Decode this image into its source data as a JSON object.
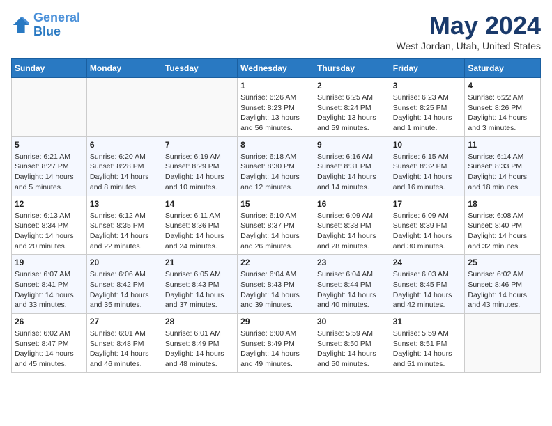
{
  "header": {
    "logo_line1": "General",
    "logo_line2": "Blue",
    "month": "May 2024",
    "location": "West Jordan, Utah, United States"
  },
  "weekdays": [
    "Sunday",
    "Monday",
    "Tuesday",
    "Wednesday",
    "Thursday",
    "Friday",
    "Saturday"
  ],
  "weeks": [
    [
      {
        "day": "",
        "info": ""
      },
      {
        "day": "",
        "info": ""
      },
      {
        "day": "",
        "info": ""
      },
      {
        "day": "1",
        "info": "Sunrise: 6:26 AM\nSunset: 8:23 PM\nDaylight: 13 hours\nand 56 minutes."
      },
      {
        "day": "2",
        "info": "Sunrise: 6:25 AM\nSunset: 8:24 PM\nDaylight: 13 hours\nand 59 minutes."
      },
      {
        "day": "3",
        "info": "Sunrise: 6:23 AM\nSunset: 8:25 PM\nDaylight: 14 hours\nand 1 minute."
      },
      {
        "day": "4",
        "info": "Sunrise: 6:22 AM\nSunset: 8:26 PM\nDaylight: 14 hours\nand 3 minutes."
      }
    ],
    [
      {
        "day": "5",
        "info": "Sunrise: 6:21 AM\nSunset: 8:27 PM\nDaylight: 14 hours\nand 5 minutes."
      },
      {
        "day": "6",
        "info": "Sunrise: 6:20 AM\nSunset: 8:28 PM\nDaylight: 14 hours\nand 8 minutes."
      },
      {
        "day": "7",
        "info": "Sunrise: 6:19 AM\nSunset: 8:29 PM\nDaylight: 14 hours\nand 10 minutes."
      },
      {
        "day": "8",
        "info": "Sunrise: 6:18 AM\nSunset: 8:30 PM\nDaylight: 14 hours\nand 12 minutes."
      },
      {
        "day": "9",
        "info": "Sunrise: 6:16 AM\nSunset: 8:31 PM\nDaylight: 14 hours\nand 14 minutes."
      },
      {
        "day": "10",
        "info": "Sunrise: 6:15 AM\nSunset: 8:32 PM\nDaylight: 14 hours\nand 16 minutes."
      },
      {
        "day": "11",
        "info": "Sunrise: 6:14 AM\nSunset: 8:33 PM\nDaylight: 14 hours\nand 18 minutes."
      }
    ],
    [
      {
        "day": "12",
        "info": "Sunrise: 6:13 AM\nSunset: 8:34 PM\nDaylight: 14 hours\nand 20 minutes."
      },
      {
        "day": "13",
        "info": "Sunrise: 6:12 AM\nSunset: 8:35 PM\nDaylight: 14 hours\nand 22 minutes."
      },
      {
        "day": "14",
        "info": "Sunrise: 6:11 AM\nSunset: 8:36 PM\nDaylight: 14 hours\nand 24 minutes."
      },
      {
        "day": "15",
        "info": "Sunrise: 6:10 AM\nSunset: 8:37 PM\nDaylight: 14 hours\nand 26 minutes."
      },
      {
        "day": "16",
        "info": "Sunrise: 6:09 AM\nSunset: 8:38 PM\nDaylight: 14 hours\nand 28 minutes."
      },
      {
        "day": "17",
        "info": "Sunrise: 6:09 AM\nSunset: 8:39 PM\nDaylight: 14 hours\nand 30 minutes."
      },
      {
        "day": "18",
        "info": "Sunrise: 6:08 AM\nSunset: 8:40 PM\nDaylight: 14 hours\nand 32 minutes."
      }
    ],
    [
      {
        "day": "19",
        "info": "Sunrise: 6:07 AM\nSunset: 8:41 PM\nDaylight: 14 hours\nand 33 minutes."
      },
      {
        "day": "20",
        "info": "Sunrise: 6:06 AM\nSunset: 8:42 PM\nDaylight: 14 hours\nand 35 minutes."
      },
      {
        "day": "21",
        "info": "Sunrise: 6:05 AM\nSunset: 8:43 PM\nDaylight: 14 hours\nand 37 minutes."
      },
      {
        "day": "22",
        "info": "Sunrise: 6:04 AM\nSunset: 8:43 PM\nDaylight: 14 hours\nand 39 minutes."
      },
      {
        "day": "23",
        "info": "Sunrise: 6:04 AM\nSunset: 8:44 PM\nDaylight: 14 hours\nand 40 minutes."
      },
      {
        "day": "24",
        "info": "Sunrise: 6:03 AM\nSunset: 8:45 PM\nDaylight: 14 hours\nand 42 minutes."
      },
      {
        "day": "25",
        "info": "Sunrise: 6:02 AM\nSunset: 8:46 PM\nDaylight: 14 hours\nand 43 minutes."
      }
    ],
    [
      {
        "day": "26",
        "info": "Sunrise: 6:02 AM\nSunset: 8:47 PM\nDaylight: 14 hours\nand 45 minutes."
      },
      {
        "day": "27",
        "info": "Sunrise: 6:01 AM\nSunset: 8:48 PM\nDaylight: 14 hours\nand 46 minutes."
      },
      {
        "day": "28",
        "info": "Sunrise: 6:01 AM\nSunset: 8:49 PM\nDaylight: 14 hours\nand 48 minutes."
      },
      {
        "day": "29",
        "info": "Sunrise: 6:00 AM\nSunset: 8:49 PM\nDaylight: 14 hours\nand 49 minutes."
      },
      {
        "day": "30",
        "info": "Sunrise: 5:59 AM\nSunset: 8:50 PM\nDaylight: 14 hours\nand 50 minutes."
      },
      {
        "day": "31",
        "info": "Sunrise: 5:59 AM\nSunset: 8:51 PM\nDaylight: 14 hours\nand 51 minutes."
      },
      {
        "day": "",
        "info": ""
      }
    ]
  ]
}
